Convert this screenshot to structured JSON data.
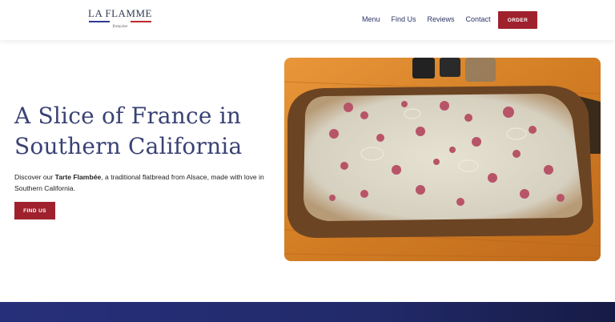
{
  "logo": {
    "name": "LA FLAMME",
    "tagline": "française"
  },
  "nav": {
    "items": [
      "Menu",
      "Find Us",
      "Reviews",
      "Contact"
    ],
    "order_label": "ORDER"
  },
  "hero": {
    "title": "A Slice of France in Southern California",
    "text_pre": "Discover our ",
    "text_bold": "Tarte Flambée",
    "text_post": ", a traditional flatbread from Alsace, made with love in Southern California.",
    "button_label": "FIND US"
  },
  "colors": {
    "brand_red": "#a0212e",
    "brand_blue": "#3a4275",
    "band": "#222a6a"
  }
}
